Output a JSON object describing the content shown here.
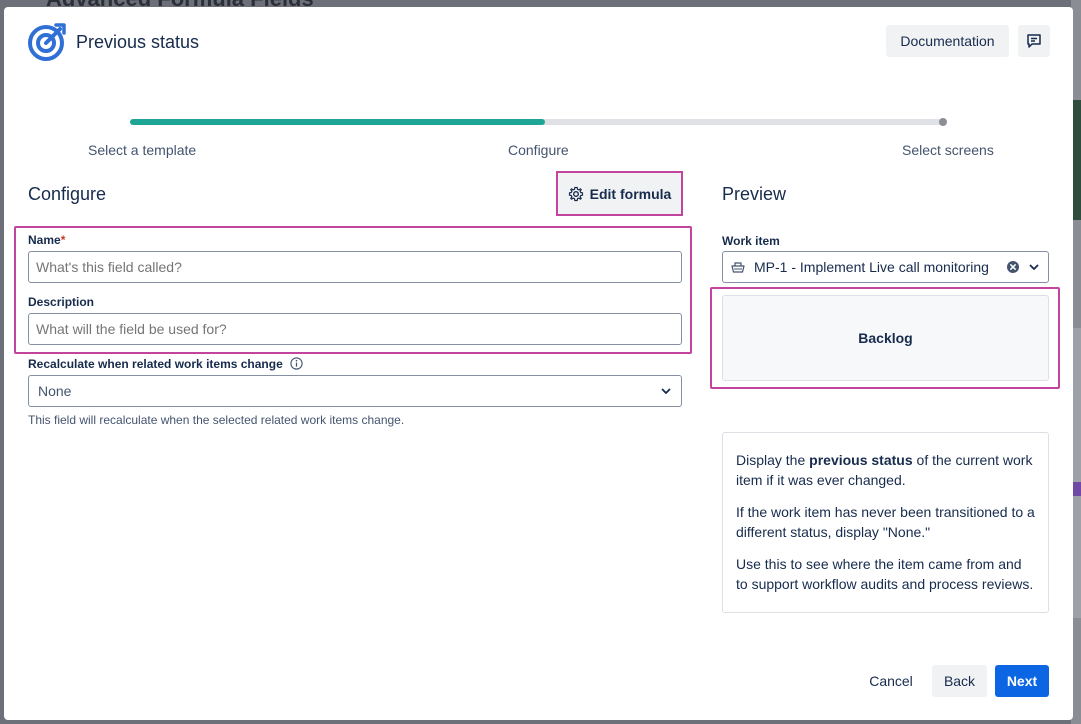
{
  "background": {
    "title": "Advanced Formula Fields"
  },
  "header": {
    "title": "Previous status",
    "documentation_label": "Documentation",
    "feedback_icon": "feedback-icon"
  },
  "progress": {
    "steps": [
      "Select a template",
      "Configure",
      "Select screens"
    ],
    "current_step": 2,
    "completed_fraction": 0.51,
    "accent": "#1fa596"
  },
  "configure": {
    "title": "Configure",
    "edit_formula_label": "Edit formula",
    "name": {
      "label": "Name",
      "required_mark": "*",
      "placeholder": "What's this field called?",
      "value": ""
    },
    "description": {
      "label": "Description",
      "placeholder": "What will the field be used for?",
      "value": ""
    },
    "recalculate": {
      "label": "Recalculate when related work items change",
      "selected": "None",
      "helper": "This field will recalculate when the selected related work items change."
    }
  },
  "preview": {
    "title": "Preview",
    "work_item_label": "Work item",
    "work_item_value": "MP-1 - Implement Live call monitoring",
    "result": "Backlog",
    "description_html_parts": {
      "p1_before": "Display the ",
      "p1_bold": "previous status",
      "p1_after": " of the current work item if it was ever changed.",
      "p2": "If the work item has never been transitioned to a different status, display \"None.\"",
      "p3": "Use this to see where the item came from and to support workflow audits and process reviews."
    }
  },
  "footer": {
    "cancel_label": "Cancel",
    "back_label": "Back",
    "next_label": "Next"
  },
  "colors": {
    "primary": "#0c66e4",
    "highlight": "#c2449f",
    "progress": "#1fa596"
  }
}
